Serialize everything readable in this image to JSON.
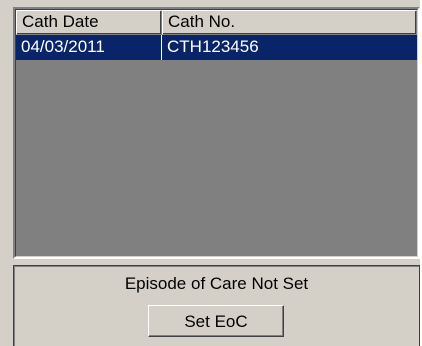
{
  "table": {
    "columns": [
      "Cath Date",
      "Cath No."
    ],
    "rows": [
      {
        "cath_date": "04/03/2011",
        "cath_no": "CTH123456",
        "selected": true
      }
    ]
  },
  "status": {
    "text": "Episode of Care Not Set",
    "button_label": "Set EoC"
  },
  "colors": {
    "panel": "#d4d0c8",
    "list_background": "#808080",
    "selection": "#0a246a"
  }
}
